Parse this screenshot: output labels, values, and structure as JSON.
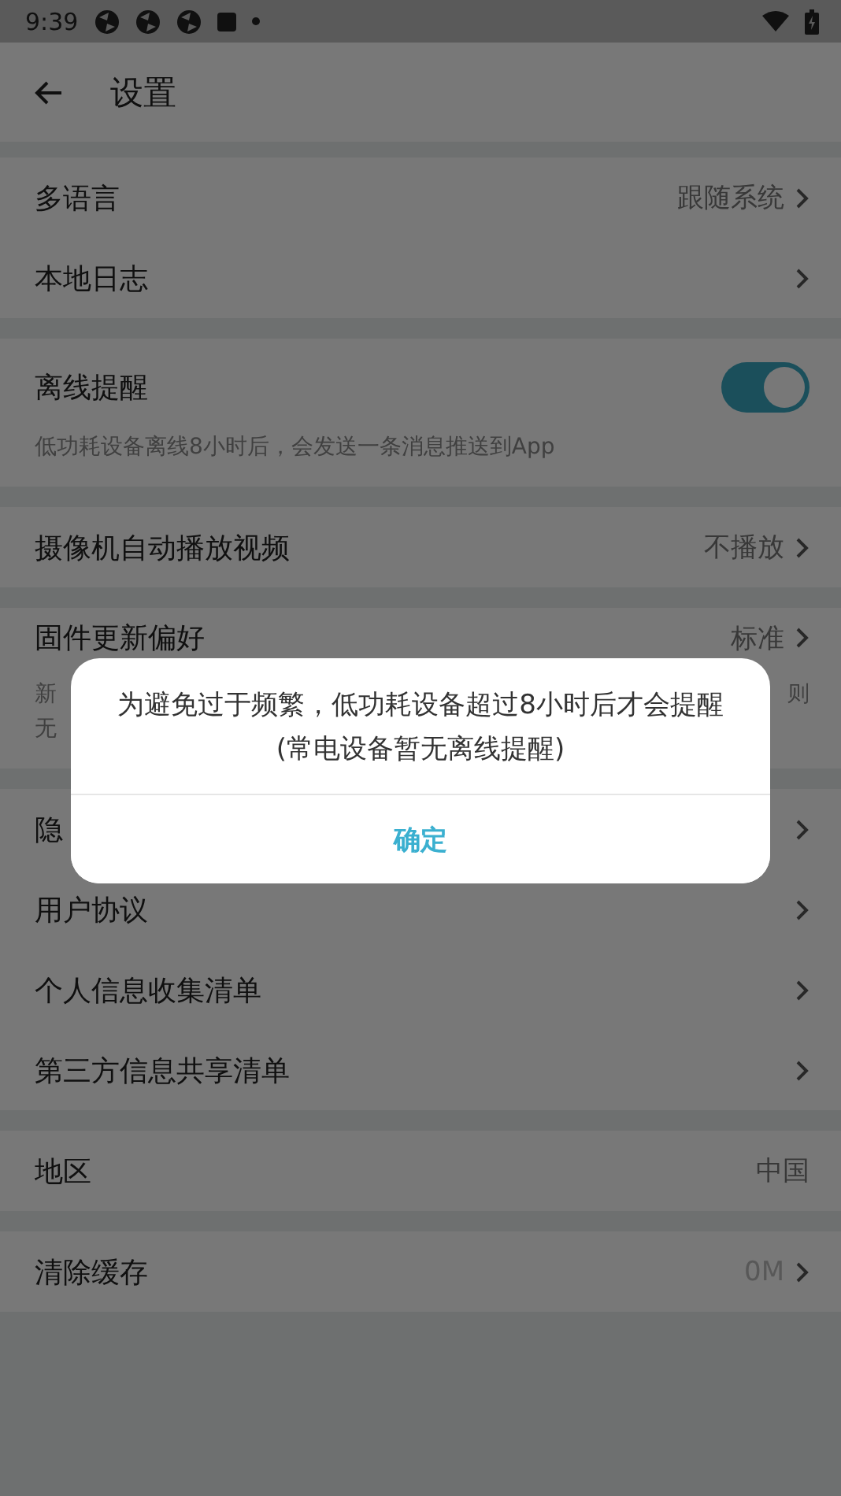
{
  "status_bar": {
    "time": "9:39"
  },
  "app_bar": {
    "title": "设置"
  },
  "sections": [
    {
      "items": [
        {
          "kind": "nav",
          "label": "多语言",
          "value": "跟随系统"
        },
        {
          "kind": "nav",
          "label": "本地日志"
        }
      ]
    },
    {
      "items": [
        {
          "kind": "toggle",
          "label": "离线提醒",
          "on": true,
          "description": "低功耗设备离线8小时后，会发送一条消息推送到App"
        }
      ]
    },
    {
      "items": [
        {
          "kind": "nav",
          "label": "摄像机自动播放视频",
          "value": "不播放"
        }
      ]
    },
    {
      "items": [
        {
          "kind": "covered",
          "label": "固件更新偏好",
          "value": "标准",
          "description_left": [
            "新",
            "无"
          ],
          "description_right": [
            "则"
          ]
        }
      ]
    },
    {
      "items": [
        {
          "kind": "nav",
          "label": "隐"
        },
        {
          "kind": "nav",
          "label": "用户协议"
        },
        {
          "kind": "nav",
          "label": "个人信息收集清单"
        },
        {
          "kind": "nav",
          "label": "第三方信息共享清单"
        }
      ]
    },
    {
      "items": [
        {
          "kind": "plain",
          "label": "地区",
          "value": "中国"
        }
      ]
    },
    {
      "items": [
        {
          "kind": "faint",
          "label": "清除缓存",
          "value": "0M"
        }
      ]
    }
  ],
  "dialog": {
    "message": "为避免过于频繁，低功耗设备超过8小时后才会提醒 (常电设备暂无离线提醒)",
    "button": "确定"
  }
}
